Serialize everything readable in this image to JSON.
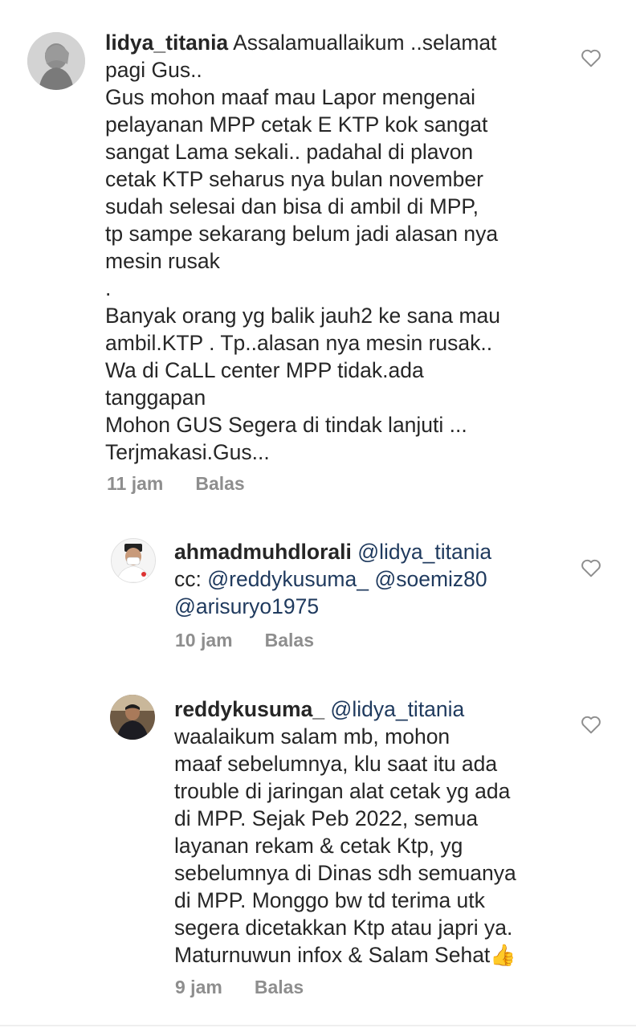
{
  "comments": [
    {
      "username": "lidya_titania",
      "text": " Assalamuallaikum ..selamat\npagi Gus..\nGus mohon maaf mau Lapor mengenai\npelayanan MPP cetak E KTP kok sangat\nsangat Lama sekali.. padahal di plavon\ncetak KTP seharus nya bulan november\nsudah selesai dan bisa di ambil di MPP,\ntp sampe sekarang belum jadi alasan nya\nmesin rusak\n.\nBanyak orang yg balik jauh2 ke sana mau\nambil.KTP . Tp..alasan nya mesin rusak..\nWa di CaLL center MPP tidak.ada\ntanggapan\nMohon GUS Segera di tindak lanjuti ...\nTerjmakasi.Gus...",
      "time": "11 jam",
      "reply": "Balas",
      "like_icon": "heart-outline-icon"
    },
    {
      "username": "ahmadmuhdlorali",
      "mention1": " @lidya_titania",
      "line2_prefix": "cc: ",
      "mention2": "@reddykusuma_",
      "mention3": " @soemiz80",
      "mention4": "@arisuryo1975",
      "time": "10 jam",
      "reply": "Balas",
      "like_icon": "heart-outline-icon"
    },
    {
      "username": "reddykusuma_",
      "mention1": " @lidya_titania",
      "text": "waalaikum salam mb, mohon\nmaaf sebelumnya, klu saat itu ada\ntrouble di jaringan alat cetak yg ada\ndi MPP. Sejak Peb 2022, semua\nlayanan rekam & cetak Ktp, yg\nsebelumnya di Dinas sdh semuanya\ndi MPP. Monggo bw td terima utk\nsegera dicetakkan Ktp atau japri ya.\nMaturnuwun infox & Salam Sehat",
      "emoji": "👍",
      "time": "9 jam",
      "reply": "Balas",
      "like_icon": "heart-outline-icon"
    }
  ],
  "colors": {
    "text": "#262626",
    "meta": "#8e8e8e",
    "mention": "#1f3a5e"
  }
}
